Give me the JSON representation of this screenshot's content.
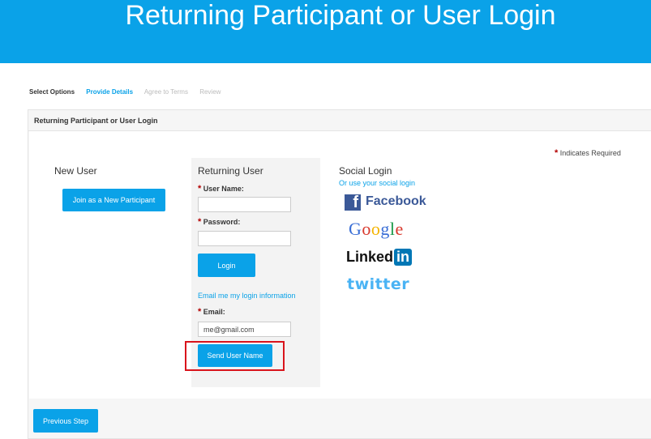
{
  "banner": {
    "title": "Returning Participant or User Login"
  },
  "steps": [
    {
      "label": "Select Options",
      "state": "done"
    },
    {
      "label": "Provide Details",
      "state": "active"
    },
    {
      "label": "Agree to Terms",
      "state": "future"
    },
    {
      "label": "Review",
      "state": "future"
    }
  ],
  "panel": {
    "title": "Returning Participant or User Login"
  },
  "required_note": {
    "star": "*",
    "text": "Indicates Required"
  },
  "new_user": {
    "title": "New User",
    "join_button": "Join as a New Participant"
  },
  "returning_user": {
    "title": "Returning User",
    "username_label": "User Name:",
    "username_value": "",
    "password_label": "Password:",
    "password_value": "",
    "login_button": "Login",
    "email_link": "Email me my login information",
    "email_label": "Email:",
    "email_value": "me@gmail.com",
    "send_button": "Send User Name",
    "required_star": "*"
  },
  "social": {
    "title": "Social Login",
    "subtitle": "Or use your social login",
    "facebook": "Facebook",
    "facebook_icon": "f",
    "google": [
      "G",
      "o",
      "o",
      "g",
      "l",
      "e"
    ],
    "linkedin_text": "Linked",
    "linkedin_box": "in",
    "twitter": "twitter"
  },
  "footer": {
    "previous_button": "Previous Step"
  },
  "colors": {
    "accent": "#0aa2e8",
    "required": "#b30000",
    "highlight": "#d9141c",
    "facebook": "#3b5998",
    "linkedin": "#0077b5",
    "twitter": "#4ab3f4",
    "google": [
      "#3b6fd6",
      "#d8382c",
      "#f4b400",
      "#3b6fd6",
      "#1a9a4a",
      "#d8382c"
    ]
  }
}
